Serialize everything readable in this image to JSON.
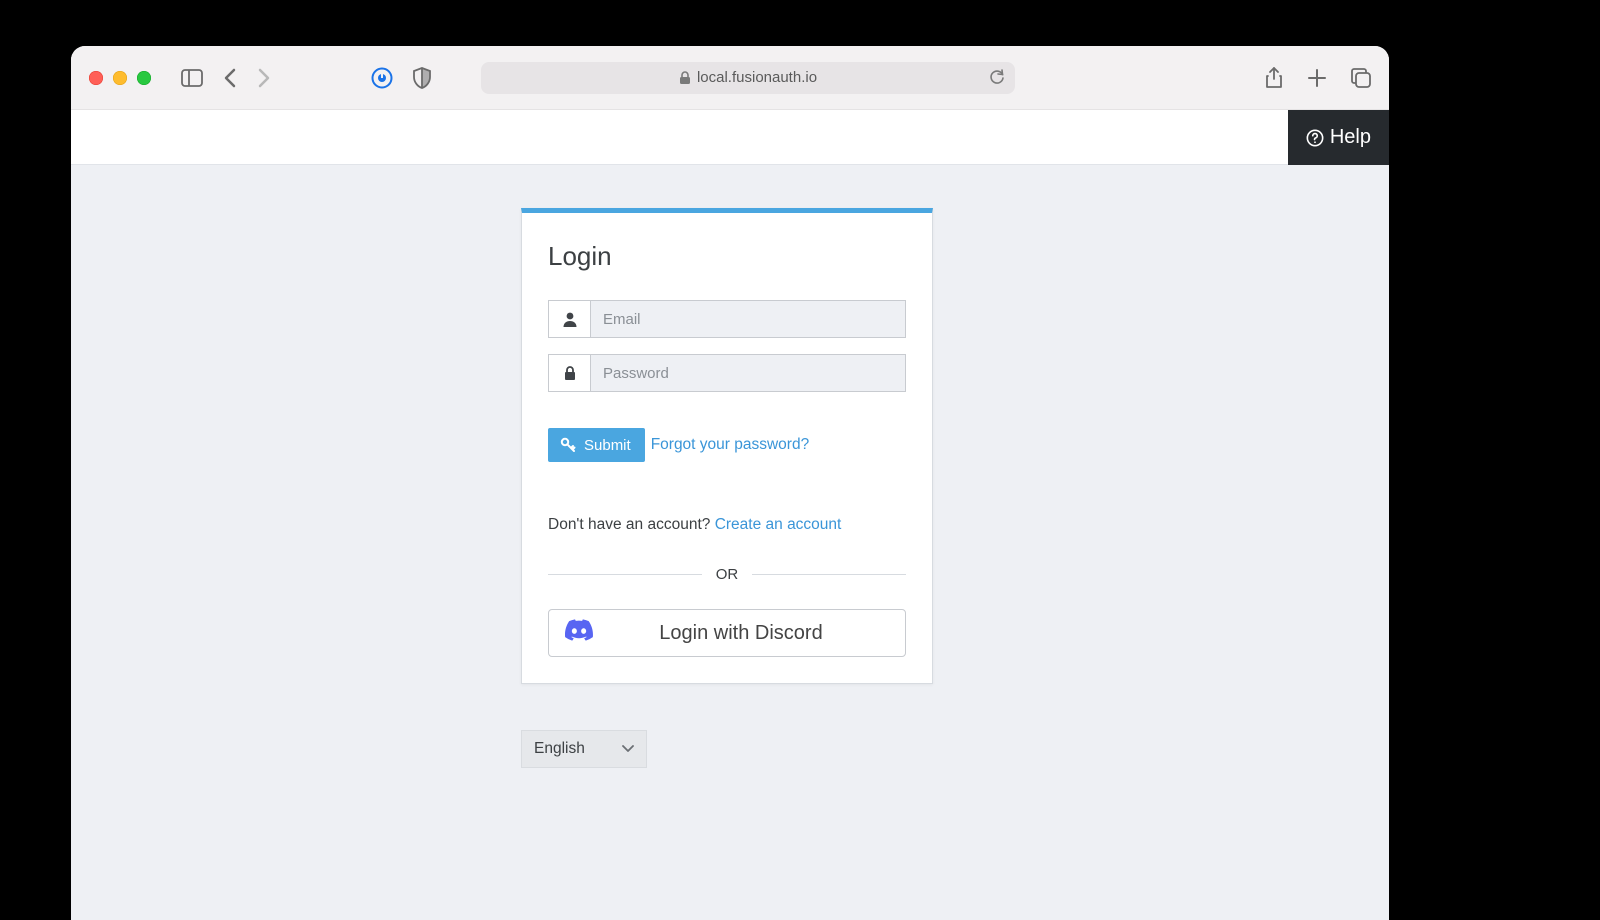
{
  "browser": {
    "url_host": "local.fusionauth.io"
  },
  "header": {
    "help_label": "Help"
  },
  "login": {
    "title": "Login",
    "email_placeholder": "Email",
    "password_placeholder": "Password",
    "submit_label": "Submit",
    "forgot_label": "Forgot your password?",
    "noacct_prefix": "Don't have an account? ",
    "create_label": "Create an account",
    "or_label": "OR",
    "discord_label": "Login with Discord"
  },
  "language": {
    "selected": "English"
  }
}
